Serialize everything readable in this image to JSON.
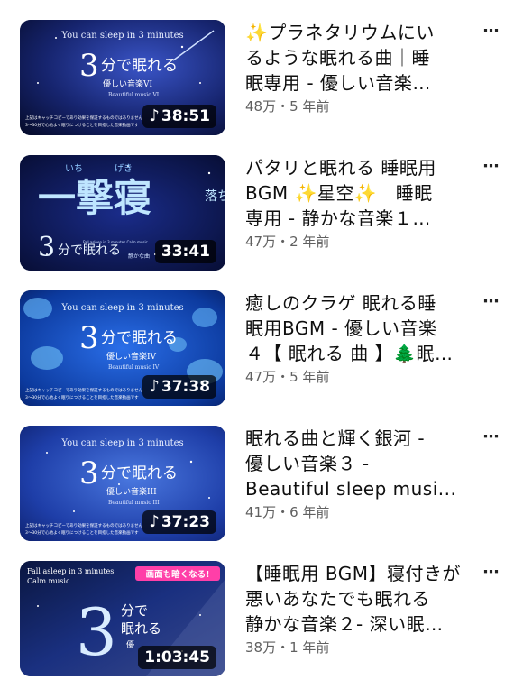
{
  "videos": [
    {
      "thumb_top": "You can sleep in 3 minutes",
      "thumb_big": "3",
      "thumb_main": "分で眠れる",
      "thumb_sub": "優しい音楽VI",
      "thumb_sub2": "Beautiful music VI",
      "thumb_caption1": "上記はキャッチコピーであり効果を保証するものではありません",
      "thumb_caption2": "3〜30分で心地よく眠りにつけることを目指した音楽動画です",
      "duration": "38:51",
      "title_line1": "✨プラネタリウムにい",
      "title_line2": "るような眠れる曲｜睡",
      "title_line3": "眠専用 - 優しい音楽…",
      "meta": "48万・5 年前",
      "accent": "#1a2a7a"
    },
    {
      "thumb_ruby1": "いち",
      "thumb_ruby2": "げき",
      "thumb_kanji": "一撃寝",
      "thumb_side": "落ち",
      "thumb_big": "3",
      "thumb_main": "分で眠れる",
      "thumb_small": "Fall asleep in 3 minutes Calm music",
      "thumb_small2": "静かな曲",
      "duration": "33:41",
      "title_line1": "パタリと眠れる 睡眠用",
      "title_line2": "BGM ✨星空✨　睡眠",
      "title_line3": "専用 - 静かな音楽１…",
      "meta": "47万・2 年前",
      "accent": "#0d1a5a"
    },
    {
      "thumb_top": "You can sleep in 3 minutes",
      "thumb_big": "3",
      "thumb_main": "分で眠れる",
      "thumb_sub": "優しい音楽IV",
      "thumb_sub2": "Beautiful music IV",
      "thumb_caption1": "上記はキャッチコピーであり効果を保証するものではありません",
      "thumb_caption2": "3〜30分で心地よく眠りにつけることを目指した音楽動画です",
      "duration": "37:38",
      "title_line1": "癒しのクラゲ 眠れる睡",
      "title_line2": "眠用BGM - 優しい音楽",
      "title_line3": "４【 眠れる 曲 】🌲眠…",
      "meta": "47万・5 年前",
      "accent": "#0a3a9a"
    },
    {
      "thumb_top": "You can sleep in 3 minutes",
      "thumb_big": "3",
      "thumb_main": "分で眠れる",
      "thumb_sub": "優しい音楽III",
      "thumb_sub2": "Beautiful music III",
      "thumb_caption1": "上記はキャッチコピーであり効果を保証するものではありません",
      "thumb_caption2": "3〜30分で心地よく眠りにつけることを目指した音楽動画です",
      "duration": "37:23",
      "title_line1": "眠れる曲と輝く銀河 -",
      "title_line2": "優しい音楽３ -",
      "title_line3": "Beautiful sleep musi...",
      "meta": "41万・6 年前",
      "accent": "#1a3aa0"
    },
    {
      "thumb_top": "Fall asleep in 3 minutes",
      "thumb_top2": "Calm music",
      "thumb_badge": "画面も暗くなる!",
      "thumb_big": "3",
      "thumb_main1": "分で",
      "thumb_main2": "眠れる",
      "thumb_sub": "優",
      "duration": "1:03:45",
      "title_line1": "【睡眠用 BGM】寝付きが",
      "title_line2": "悪いあなたでも眠れる",
      "title_line3": "静かな音楽２- 深い眠…",
      "meta": "38万・1 年前",
      "accent": "#10204a"
    }
  ],
  "more_icon": "more-vert-icon"
}
